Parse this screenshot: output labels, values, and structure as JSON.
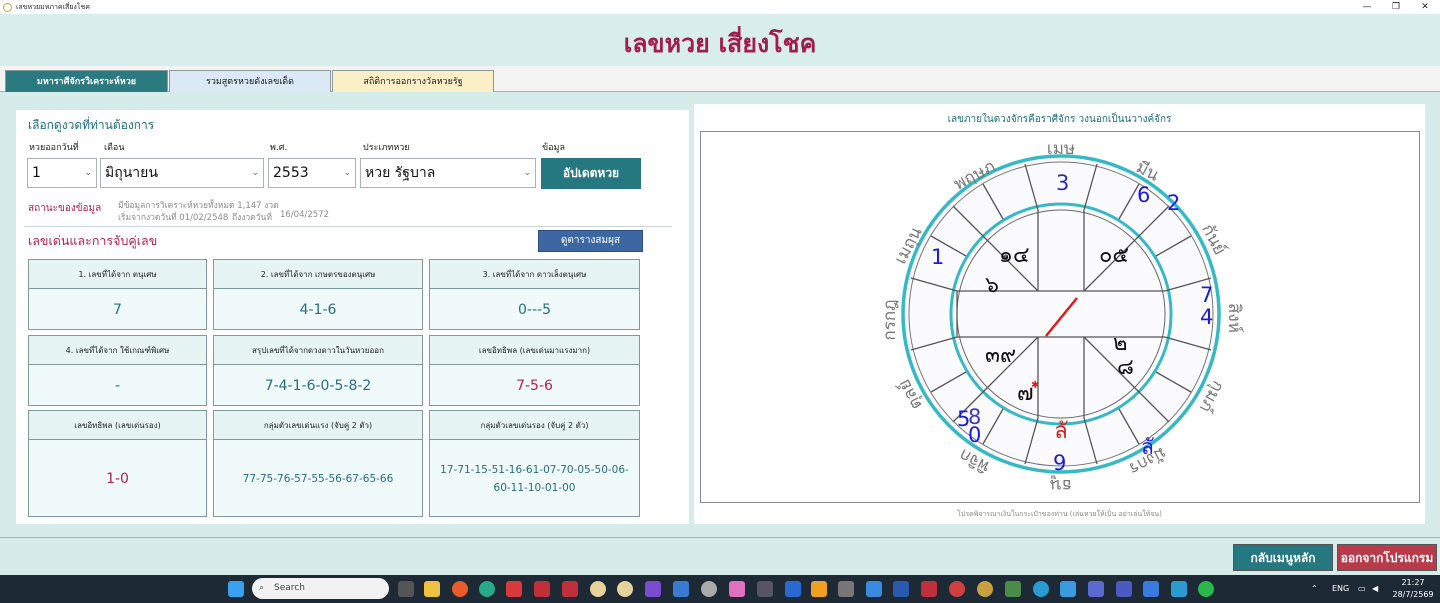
{
  "window": {
    "title": "เลขหวยมหภาคเสี่ยงโชค",
    "min": "—",
    "restore": "❐",
    "close": "✕"
  },
  "app_title": "เลขหวย เสี่ยงโชค",
  "tabs": [
    {
      "label": "มหาราศีจักรวิเคราะห์หวย"
    },
    {
      "label": "รวมสูตรหวยดังเลขเด็ด"
    },
    {
      "label": "สถิติการออกรางวัลหวยรัฐ"
    }
  ],
  "selection": {
    "title": "เลือกดูงวดที่ท่านต้องการ",
    "labels": {
      "day": "หวยออกวันที่",
      "month": "เดือน",
      "year": "พ.ศ.",
      "type": "ประเภทหวย",
      "info": "ข้อมูล"
    },
    "day": "1",
    "month": "มิถุนายน",
    "year": "2553",
    "type": "หวย รัฐบาล",
    "update_button": "อัปเดตหวย"
  },
  "status": {
    "label": "สถานะของข้อมูล",
    "line1": "มีข้อมูลการวิเคราะห์หวยทั้งหมด 1,147 งวด",
    "line2a": "เริ่มจากงวดวันที่ 01/02/2548",
    "line2b": "ถึงงวดวันที่",
    "line2c": "16/04/2572"
  },
  "numbers": {
    "title": "เลขเด่นและการจับคู่เลข",
    "table_button": "ดูตารางสมผุส",
    "cards": [
      {
        "header": "1. เลขที่ได้จาก  ตนุเศษ",
        "value": "7"
      },
      {
        "header": "2. เลขที่ได้จาก  เกษตรของตนุเศษ",
        "value": "4-1-6"
      },
      {
        "header": "3. เลขที่ได้จาก  ดาวเล็งตนุเศษ",
        "value": "0---5"
      },
      {
        "header": "4. เลขที่ได้จาก  ใช้เกณฑ์พิเศษ",
        "value": "-"
      },
      {
        "header": "สรุปเลขที่ได้จากดวงดาวในวันหวยออก",
        "value": "7-4-1-6-0-5-8-2"
      },
      {
        "header": "เลขอิทธิพล (เลขเด่นมาแรงมาก)",
        "value": "7-5-6"
      },
      {
        "header": "เลขอิทธิพล (เลขเด่นรอง)",
        "value": "1-0"
      },
      {
        "header": "กลุ่มตัวเลขเด่นแรง (จับคู่ 2 ตัว)",
        "value": "77-75-76-57-55-56-67-65-66"
      },
      {
        "header": "กลุ่มตัวเลขเด่นรอง (จับคู่ 2 ตัว)",
        "value": "17-71-15-51-16-61-07-70-05-50-06-60-11-10-01-00"
      }
    ]
  },
  "wheel": {
    "title": "เลขภายในดวงจักรคือราศีจักร วงนอกเป็นนวางค์จักร",
    "footer": "โปรดพิจารณาเงินในกระเป๋าของท่าน (เล่นหวยให้เป็น อย่าเล่นให้จน)",
    "signs": [
      "เมษ",
      "พฤษภ",
      "เมถุน",
      "กรกฎ",
      "สิงห์",
      "กันย์",
      "ตุลย์",
      "พิจิก",
      "ธนู",
      "มังกร",
      "กุมภ์",
      "มีน"
    ],
    "inner": [
      "๑๔",
      "๐๕",
      "๖",
      "๒",
      "๓๙",
      "๘",
      "๗",
      "ลั"
    ],
    "nav": [
      "3",
      "6",
      "2",
      "1",
      "7",
      "4",
      "5",
      "8",
      "0",
      "9",
      "ลั"
    ]
  },
  "bottom": {
    "main_menu": "กลับเมนูหลัก",
    "exit": "ออกจากโปรแกรม"
  },
  "taskbar": {
    "search": "Search",
    "lang": "ENG",
    "time": "21:27",
    "date": "28/7/2569"
  }
}
